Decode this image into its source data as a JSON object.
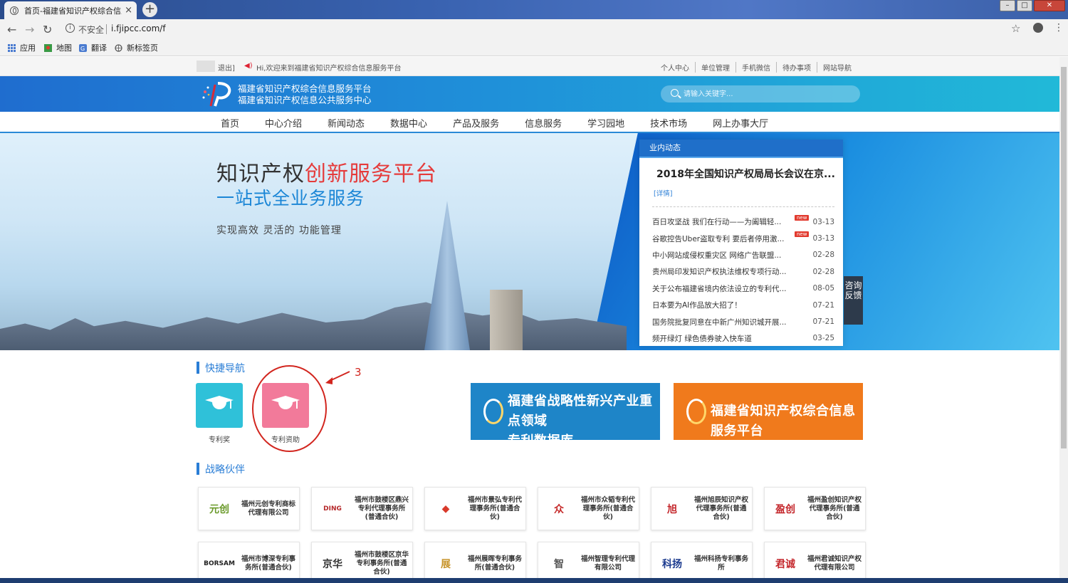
{
  "browser": {
    "tab_title": "首页-福建省知识产权综合信息服",
    "tab_close": "×",
    "new_tab": "+",
    "insecure_label": "不安全",
    "url": "i.fjipcc.com/f",
    "bookmarks": [
      "应用",
      "地图",
      "翻译",
      "新标签页"
    ]
  },
  "topstrip": {
    "logout": "退出]",
    "welcome": "Hi,欢迎来到福建省知识产权综合信息服务平台",
    "links": [
      "个人中心",
      "单位管理",
      "手机微信",
      "待办事项",
      "网站导航"
    ]
  },
  "header": {
    "site_name_1": "福建省知识产权综合信息服务平台",
    "site_name_2": "福建省知识产权信息公共服务中心",
    "search_placeholder": "请输入关键字..."
  },
  "nav": [
    "首页",
    "中心介绍",
    "新闻动态",
    "数据中心",
    "产品及服务",
    "信息服务",
    "学习园地",
    "技术市场",
    "网上办事大厅"
  ],
  "banner": {
    "slogan_black": "知识产权",
    "slogan_red": "创新服务平台",
    "slogan_sub": "一站式全业务服务",
    "slogan_small": "实现高效 灵活的 功能管理"
  },
  "news": {
    "header": "业内动态",
    "headline": "2018年全国知识产权局局长会议在京...",
    "detail_link": "[详情]",
    "new_badge": "new",
    "items": [
      {
        "title": "百日攻坚战 我们在行动——为阖辑轻...",
        "date": "03-13",
        "is_new": true
      },
      {
        "title": "谷歌控告Uber盗取专利 要后者停用激...",
        "date": "03-13",
        "is_new": true
      },
      {
        "title": "中小网站成侵权重灾区 网络广告联盟...",
        "date": "02-28",
        "is_new": false
      },
      {
        "title": "贵州局印发知识产权执法维权专项行动...",
        "date": "02-28",
        "is_new": false
      },
      {
        "title": "关于公布福建省境内依法设立的专利代...",
        "date": "08-05",
        "is_new": false
      },
      {
        "title": "日本要为AI作品放大招了！",
        "date": "07-21",
        "is_new": false
      },
      {
        "title": "国务院批复同意在中新广州知识城开展...",
        "date": "07-21",
        "is_new": false
      },
      {
        "title": "频开绿灯 绿色债券驶入快车道",
        "date": "03-25",
        "is_new": false
      }
    ]
  },
  "consult": "咨询反馈",
  "quicknav": {
    "title": "快捷导航",
    "items": [
      {
        "label": "专利奖",
        "color": "#2fc1d9"
      },
      {
        "label": "专利资助",
        "color": "#f27a9a"
      }
    ],
    "annotation_number": "3"
  },
  "promos": [
    {
      "line1": "福建省战略性新兴产业重点领域",
      "line2": "专利数据库",
      "color": "#1e85c8"
    },
    {
      "line1": "福建省知识产权综合信息服务平台",
      "line2": "",
      "color": "#f07a1c"
    }
  ],
  "partners": {
    "title": "战略伙伴",
    "row1": [
      {
        "mark": "元创",
        "name": "福州元创专利商标代理有限公司",
        "color": "#6a9a2a"
      },
      {
        "mark": "DING",
        "name": "福州市鼓楼区鼎兴专利代理事务所(普通合伙)",
        "color": "#b5282a"
      },
      {
        "mark": "◆",
        "name": "福州市景弘专利代理事务所(普通合伙)",
        "color": "#d93a2b"
      },
      {
        "mark": "众",
        "name": "福州市众韬专利代理事务所(普通合伙)",
        "color": "#c62c2c"
      },
      {
        "mark": "旭",
        "name": "福州旭辰知识产权代理事务所(普通合伙)",
        "color": "#c4262b"
      },
      {
        "mark": "盈创",
        "name": "福州盈创知识产权代理事务所(普通合伙)",
        "color": "#c4262b"
      }
    ],
    "row2": [
      {
        "mark": "BORSAM",
        "name": "福州市博深专利事务所(普通合伙)",
        "color": "#222"
      },
      {
        "mark": "京华",
        "name": "福州市鼓楼区京华专利事务所(普通合伙)",
        "color": "#333"
      },
      {
        "mark": "展",
        "name": "福州展晖专利事务所(普通合伙)",
        "color": "#c8952c"
      },
      {
        "mark": "智",
        "name": "福州智理专利代理有限公司",
        "color": "#555"
      },
      {
        "mark": "科扬",
        "name": "福州科扬专利事务所",
        "color": "#1c3b8f"
      },
      {
        "mark": "君诚",
        "name": "福州君诚知识产权代理有限公司",
        "color": "#c4262b"
      }
    ]
  }
}
